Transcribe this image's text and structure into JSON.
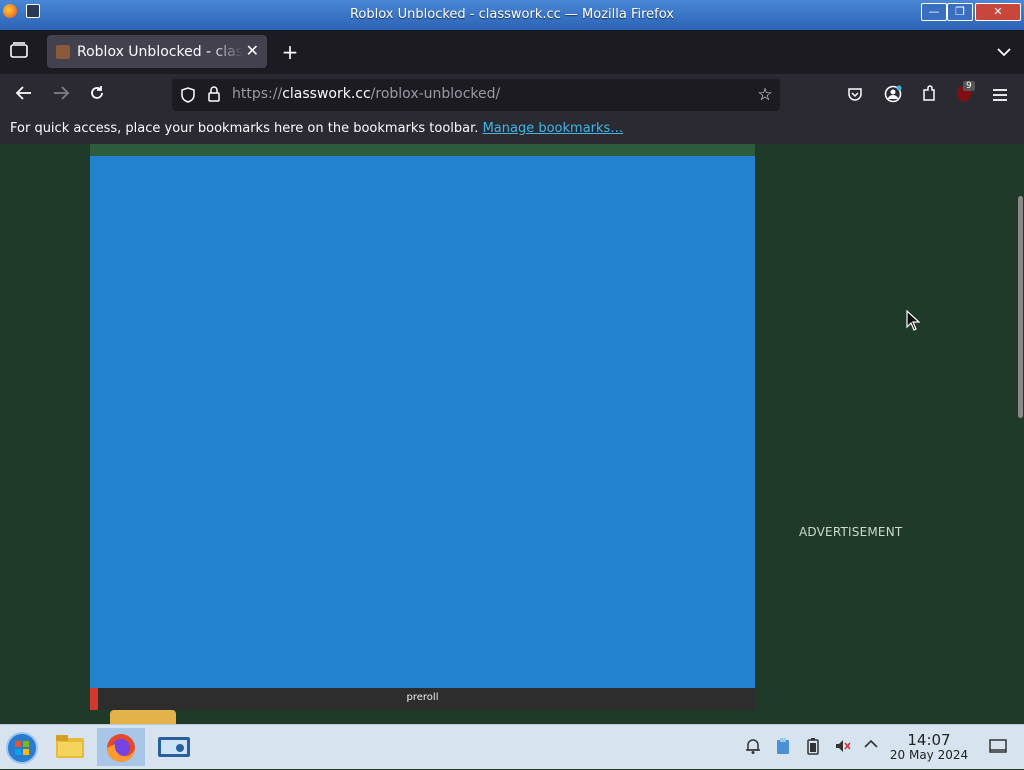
{
  "window": {
    "title": "Roblox Unblocked - classwork.cc — Mozilla Firefox",
    "controls": [
      "minimize",
      "restore",
      "close"
    ]
  },
  "browser": {
    "tab": {
      "label": "Roblox Unblocked - classwork.cc",
      "close_icon": "close-icon"
    },
    "new_tab_icon": "plus-icon",
    "url": {
      "scheme": "https://",
      "host": "classwork.cc",
      "path": "/roblox-unblocked/"
    },
    "extensions_badge": "9",
    "bookmarks_bar": {
      "message": "For quick access, place your bookmarks here on the bookmarks toolbar.",
      "link": "Manage bookmarks…"
    }
  },
  "page": {
    "video_caption": "preroll",
    "preroll_progress": 0.012,
    "ad_label": "ADVERTISEMENT",
    "colors": {
      "background": "#1f3a28",
      "video": "#2282cf",
      "progress": "#d3382e"
    }
  },
  "taskbar": {
    "time": "14:07",
    "date": "20 May 2024",
    "apps": [
      "start-orb-icon",
      "file-manager-icon",
      "firefox-icon",
      "system-settings-icon"
    ]
  }
}
